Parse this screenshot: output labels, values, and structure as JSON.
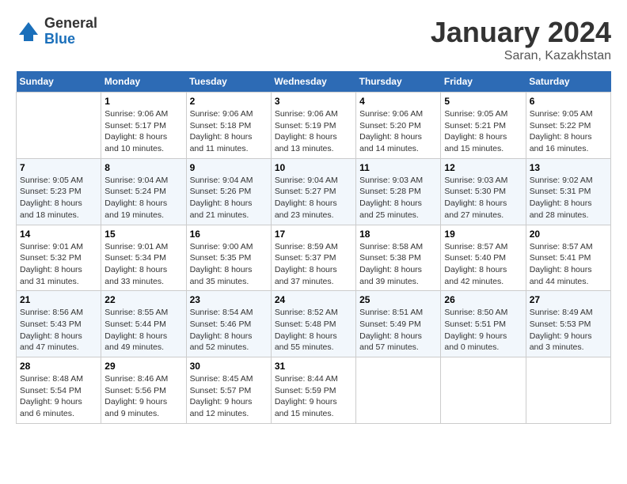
{
  "header": {
    "logo": {
      "general": "General",
      "blue": "Blue"
    },
    "title": "January 2024",
    "location": "Saran, Kazakhstan"
  },
  "weekdays": [
    "Sunday",
    "Monday",
    "Tuesday",
    "Wednesday",
    "Thursday",
    "Friday",
    "Saturday"
  ],
  "weeks": [
    [
      {
        "day": "",
        "sunrise": "",
        "sunset": "",
        "daylight": ""
      },
      {
        "day": "1",
        "sunrise": "Sunrise: 9:06 AM",
        "sunset": "Sunset: 5:17 PM",
        "daylight": "Daylight: 8 hours and 10 minutes."
      },
      {
        "day": "2",
        "sunrise": "Sunrise: 9:06 AM",
        "sunset": "Sunset: 5:18 PM",
        "daylight": "Daylight: 8 hours and 11 minutes."
      },
      {
        "day": "3",
        "sunrise": "Sunrise: 9:06 AM",
        "sunset": "Sunset: 5:19 PM",
        "daylight": "Daylight: 8 hours and 13 minutes."
      },
      {
        "day": "4",
        "sunrise": "Sunrise: 9:06 AM",
        "sunset": "Sunset: 5:20 PM",
        "daylight": "Daylight: 8 hours and 14 minutes."
      },
      {
        "day": "5",
        "sunrise": "Sunrise: 9:05 AM",
        "sunset": "Sunset: 5:21 PM",
        "daylight": "Daylight: 8 hours and 15 minutes."
      },
      {
        "day": "6",
        "sunrise": "Sunrise: 9:05 AM",
        "sunset": "Sunset: 5:22 PM",
        "daylight": "Daylight: 8 hours and 16 minutes."
      }
    ],
    [
      {
        "day": "7",
        "sunrise": "Sunrise: 9:05 AM",
        "sunset": "Sunset: 5:23 PM",
        "daylight": "Daylight: 8 hours and 18 minutes."
      },
      {
        "day": "8",
        "sunrise": "Sunrise: 9:04 AM",
        "sunset": "Sunset: 5:24 PM",
        "daylight": "Daylight: 8 hours and 19 minutes."
      },
      {
        "day": "9",
        "sunrise": "Sunrise: 9:04 AM",
        "sunset": "Sunset: 5:26 PM",
        "daylight": "Daylight: 8 hours and 21 minutes."
      },
      {
        "day": "10",
        "sunrise": "Sunrise: 9:04 AM",
        "sunset": "Sunset: 5:27 PM",
        "daylight": "Daylight: 8 hours and 23 minutes."
      },
      {
        "day": "11",
        "sunrise": "Sunrise: 9:03 AM",
        "sunset": "Sunset: 5:28 PM",
        "daylight": "Daylight: 8 hours and 25 minutes."
      },
      {
        "day": "12",
        "sunrise": "Sunrise: 9:03 AM",
        "sunset": "Sunset: 5:30 PM",
        "daylight": "Daylight: 8 hours and 27 minutes."
      },
      {
        "day": "13",
        "sunrise": "Sunrise: 9:02 AM",
        "sunset": "Sunset: 5:31 PM",
        "daylight": "Daylight: 8 hours and 28 minutes."
      }
    ],
    [
      {
        "day": "14",
        "sunrise": "Sunrise: 9:01 AM",
        "sunset": "Sunset: 5:32 PM",
        "daylight": "Daylight: 8 hours and 31 minutes."
      },
      {
        "day": "15",
        "sunrise": "Sunrise: 9:01 AM",
        "sunset": "Sunset: 5:34 PM",
        "daylight": "Daylight: 8 hours and 33 minutes."
      },
      {
        "day": "16",
        "sunrise": "Sunrise: 9:00 AM",
        "sunset": "Sunset: 5:35 PM",
        "daylight": "Daylight: 8 hours and 35 minutes."
      },
      {
        "day": "17",
        "sunrise": "Sunrise: 8:59 AM",
        "sunset": "Sunset: 5:37 PM",
        "daylight": "Daylight: 8 hours and 37 minutes."
      },
      {
        "day": "18",
        "sunrise": "Sunrise: 8:58 AM",
        "sunset": "Sunset: 5:38 PM",
        "daylight": "Daylight: 8 hours and 39 minutes."
      },
      {
        "day": "19",
        "sunrise": "Sunrise: 8:57 AM",
        "sunset": "Sunset: 5:40 PM",
        "daylight": "Daylight: 8 hours and 42 minutes."
      },
      {
        "day": "20",
        "sunrise": "Sunrise: 8:57 AM",
        "sunset": "Sunset: 5:41 PM",
        "daylight": "Daylight: 8 hours and 44 minutes."
      }
    ],
    [
      {
        "day": "21",
        "sunrise": "Sunrise: 8:56 AM",
        "sunset": "Sunset: 5:43 PM",
        "daylight": "Daylight: 8 hours and 47 minutes."
      },
      {
        "day": "22",
        "sunrise": "Sunrise: 8:55 AM",
        "sunset": "Sunset: 5:44 PM",
        "daylight": "Daylight: 8 hours and 49 minutes."
      },
      {
        "day": "23",
        "sunrise": "Sunrise: 8:54 AM",
        "sunset": "Sunset: 5:46 PM",
        "daylight": "Daylight: 8 hours and 52 minutes."
      },
      {
        "day": "24",
        "sunrise": "Sunrise: 8:52 AM",
        "sunset": "Sunset: 5:48 PM",
        "daylight": "Daylight: 8 hours and 55 minutes."
      },
      {
        "day": "25",
        "sunrise": "Sunrise: 8:51 AM",
        "sunset": "Sunset: 5:49 PM",
        "daylight": "Daylight: 8 hours and 57 minutes."
      },
      {
        "day": "26",
        "sunrise": "Sunrise: 8:50 AM",
        "sunset": "Sunset: 5:51 PM",
        "daylight": "Daylight: 9 hours and 0 minutes."
      },
      {
        "day": "27",
        "sunrise": "Sunrise: 8:49 AM",
        "sunset": "Sunset: 5:53 PM",
        "daylight": "Daylight: 9 hours and 3 minutes."
      }
    ],
    [
      {
        "day": "28",
        "sunrise": "Sunrise: 8:48 AM",
        "sunset": "Sunset: 5:54 PM",
        "daylight": "Daylight: 9 hours and 6 minutes."
      },
      {
        "day": "29",
        "sunrise": "Sunrise: 8:46 AM",
        "sunset": "Sunset: 5:56 PM",
        "daylight": "Daylight: 9 hours and 9 minutes."
      },
      {
        "day": "30",
        "sunrise": "Sunrise: 8:45 AM",
        "sunset": "Sunset: 5:57 PM",
        "daylight": "Daylight: 9 hours and 12 minutes."
      },
      {
        "day": "31",
        "sunrise": "Sunrise: 8:44 AM",
        "sunset": "Sunset: 5:59 PM",
        "daylight": "Daylight: 9 hours and 15 minutes."
      },
      {
        "day": "",
        "sunrise": "",
        "sunset": "",
        "daylight": ""
      },
      {
        "day": "",
        "sunrise": "",
        "sunset": "",
        "daylight": ""
      },
      {
        "day": "",
        "sunrise": "",
        "sunset": "",
        "daylight": ""
      }
    ]
  ]
}
